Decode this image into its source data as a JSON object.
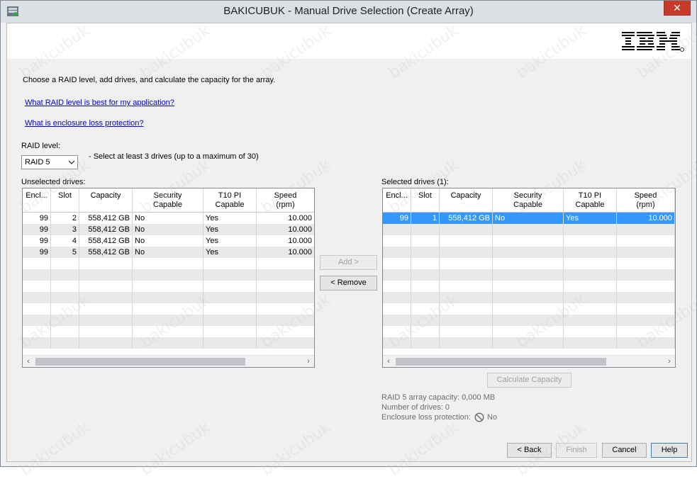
{
  "window": {
    "title": "BAKICUBUK - Manual Drive Selection (Create Array)",
    "close_glyph": "✕"
  },
  "banner": {
    "logo": "IBM"
  },
  "intro": {
    "instruction": "Choose a RAID level, add drives, and calculate the capacity for the array.",
    "link_raid": "What RAID level is best for my application?",
    "link_enclosure": "What is enclosure loss protection?"
  },
  "raid": {
    "label": "RAID level:",
    "selected": "RAID 5",
    "hint": "- Select at least 3 drives (up to a maximum of 30)"
  },
  "unselected": {
    "label": "Unselected drives:",
    "columns": [
      "Encl...",
      "Slot",
      "Capacity",
      "Security\nCapable",
      "T10 PI\nCapable",
      "Speed\n(rpm)"
    ],
    "rows": [
      [
        "99",
        "2",
        "558,412 GB",
        "No",
        "Yes",
        "10.000"
      ],
      [
        "99",
        "3",
        "558,412 GB",
        "No",
        "Yes",
        "10.000"
      ],
      [
        "99",
        "4",
        "558,412 GB",
        "No",
        "Yes",
        "10.000"
      ],
      [
        "99",
        "5",
        "558,412 GB",
        "No",
        "Yes",
        "10.000"
      ]
    ]
  },
  "selected": {
    "label": "Selected drives (1):",
    "columns": [
      "Encl...",
      "Slot",
      "Capacity",
      "Security\nCapable",
      "T10 PI\nCapable",
      "Speed\n(rpm)"
    ],
    "rows": [
      [
        "99",
        "1",
        "558,412 GB",
        "No",
        "Yes",
        "10.000"
      ]
    ]
  },
  "buttons": {
    "add": "Add >",
    "remove": "< Remove",
    "calculate": "Calculate Capacity",
    "back": "< Back",
    "finish": "Finish",
    "cancel": "Cancel",
    "help": "Help"
  },
  "summary": {
    "capacity": "RAID 5 array capacity: 0,000 MB",
    "drives": "Number of drives: 0",
    "enclosure_label": "Enclosure loss protection:",
    "enclosure_value": "No"
  },
  "watermark": "bakicubuk",
  "colors": {
    "selection": "#3399ff",
    "link": "#0000cc",
    "close": "#c73b2b"
  }
}
